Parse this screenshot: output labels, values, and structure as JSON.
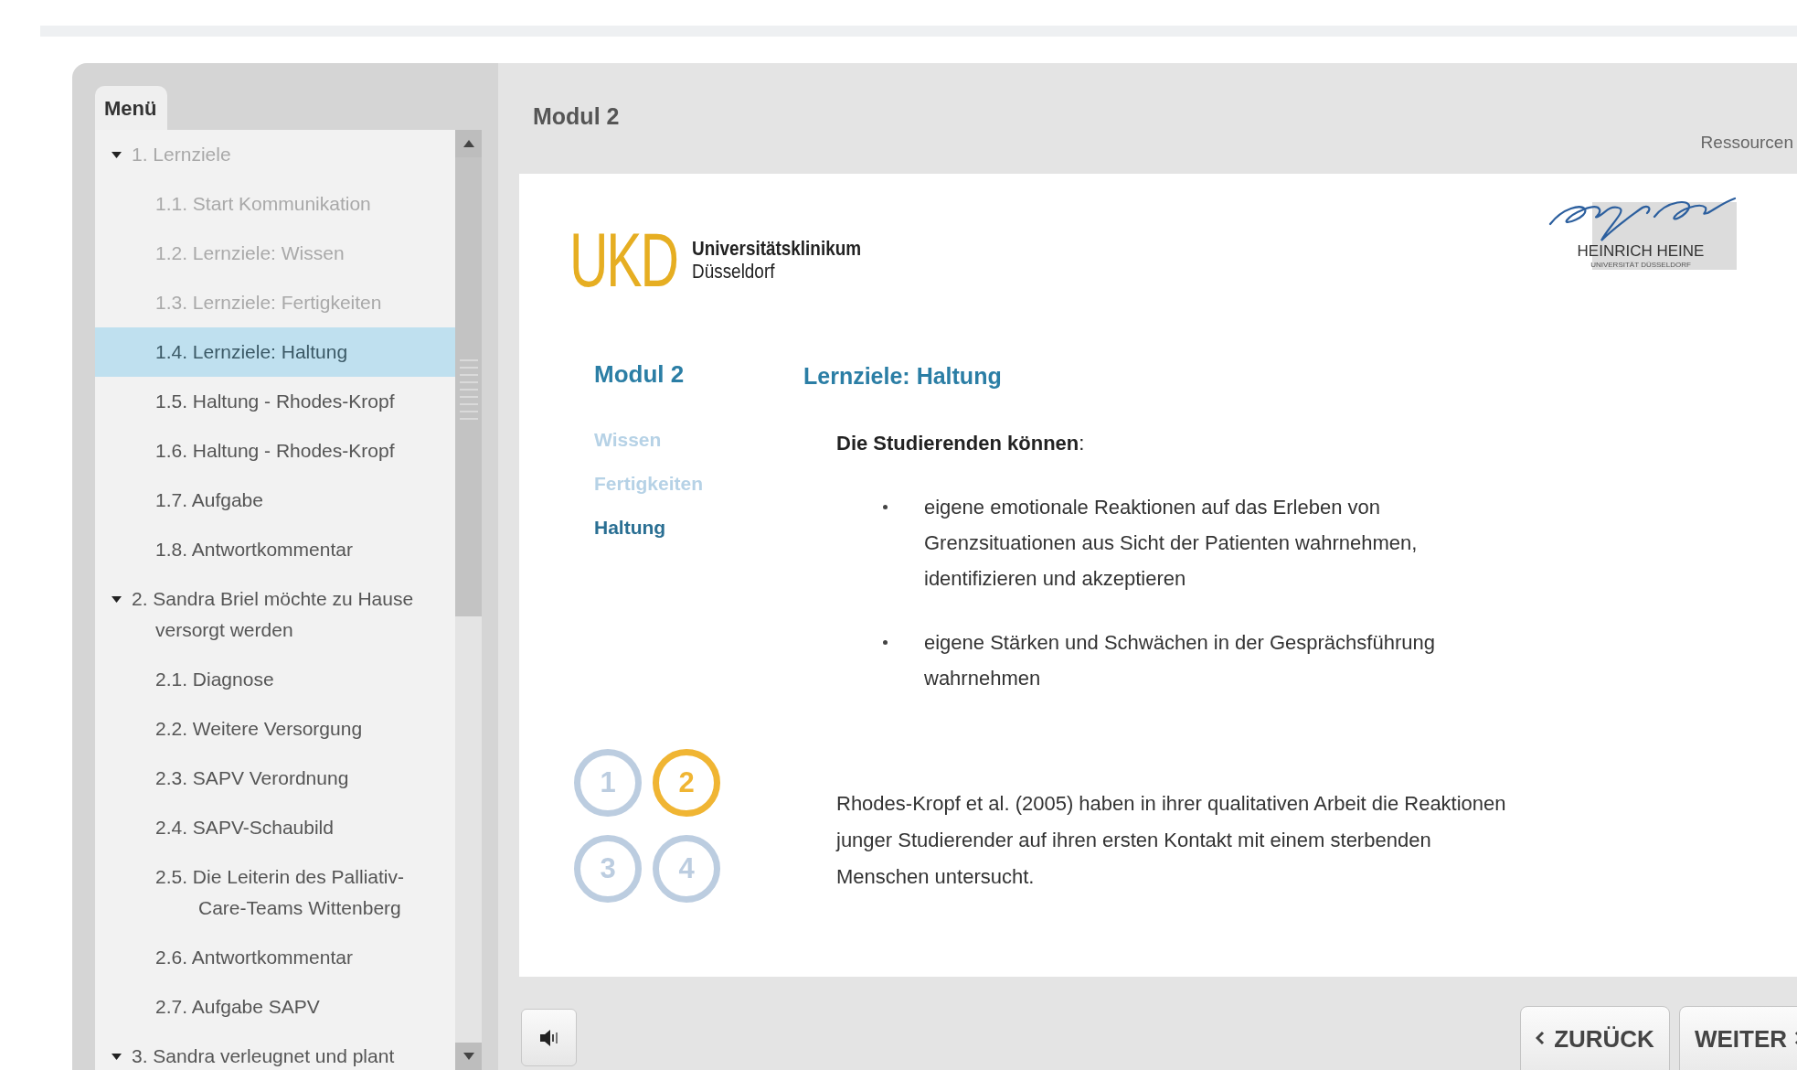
{
  "header": {
    "title": "Modul 2",
    "resources_link": "Ressourcen"
  },
  "menu": {
    "title": "Menü",
    "items": [
      {
        "label": "1. Lernziele",
        "expanded": true,
        "visited": true,
        "selected": false,
        "children": [
          {
            "label": "1.1. Start Kommunikation",
            "visited": true,
            "selected": false
          },
          {
            "label": "1.2. Lernziele: Wissen",
            "visited": true,
            "selected": false
          },
          {
            "label": "1.3. Lernziele: Fertigkeiten",
            "visited": true,
            "selected": false
          },
          {
            "label": "1.4. Lernziele: Haltung",
            "visited": false,
            "selected": true
          },
          {
            "label": "1.5. Haltung - Rhodes-Kropf",
            "visited": false,
            "selected": false
          },
          {
            "label": "1.6. Haltung - Rhodes-Kropf",
            "visited": false,
            "selected": false
          },
          {
            "label": "1.7. Aufgabe",
            "visited": false,
            "selected": false
          },
          {
            "label": "1.8. Antwortkommentar",
            "visited": false,
            "selected": false
          }
        ]
      },
      {
        "label": "2. Sandra Briel möchte zu Hause versorgt werden",
        "expanded": true,
        "visited": false,
        "selected": false,
        "children": [
          {
            "label": "2.1. Diagnose",
            "visited": false,
            "selected": false
          },
          {
            "label": "2.2. Weitere Versorgung",
            "visited": false,
            "selected": false
          },
          {
            "label": "2.3. SAPV Verordnung",
            "visited": false,
            "selected": false
          },
          {
            "label": "2.4. SAPV-Schaubild",
            "visited": false,
            "selected": false
          },
          {
            "label": "2.5. Die Leiterin des Palliativ-Care-Teams Wittenberg",
            "visited": false,
            "selected": false
          },
          {
            "label": "2.6. Antwortkommentar",
            "visited": false,
            "selected": false
          },
          {
            "label": "2.7. Aufgabe SAPV",
            "visited": false,
            "selected": false
          }
        ]
      },
      {
        "label": "3. Sandra verleugnet und plant",
        "expanded": true,
        "visited": false,
        "selected": false
      }
    ]
  },
  "slide": {
    "ukd_logo": {
      "letters": "UKD",
      "name": "Universitätsklinikum",
      "city": "Düsseldorf"
    },
    "hhu_logo": {
      "name": "HEINRICH HEINE",
      "subtitle": "UNIVERSITÄT DÜSSELDORF"
    },
    "module_title": "Modul 2",
    "sections": [
      {
        "label": "Wissen",
        "selected": false
      },
      {
        "label": "Fertigkeiten",
        "selected": false
      },
      {
        "label": "Haltung",
        "selected": true
      }
    ],
    "heading": "Lernziele: Haltung",
    "intro": "**Die Studierenden können**:",
    "bullets": [
      "eigene emotionale Reaktionen auf das Erleben von Grenzsituationen aus Sicht der Patienten wahrnehmen, identifizieren und akzeptieren",
      "eigene Stärken und Schwächen in der Gesprächsführung wahrnehmen"
    ],
    "pages": [
      {
        "label": "1",
        "selected": false
      },
      {
        "label": "2",
        "selected": true
      },
      {
        "label": "3",
        "selected": false
      },
      {
        "label": "4",
        "selected": false
      }
    ],
    "paragraph": "Rhodes-Kropf et al. (2005) haben in ihrer qualitativen Arbeit die Reaktionen junger Studierender auf ihren ersten Kontakt mit einem sterbenden Menschen untersucht."
  },
  "controls": {
    "back": "ZURÜCK",
    "next": "WEITER"
  }
}
